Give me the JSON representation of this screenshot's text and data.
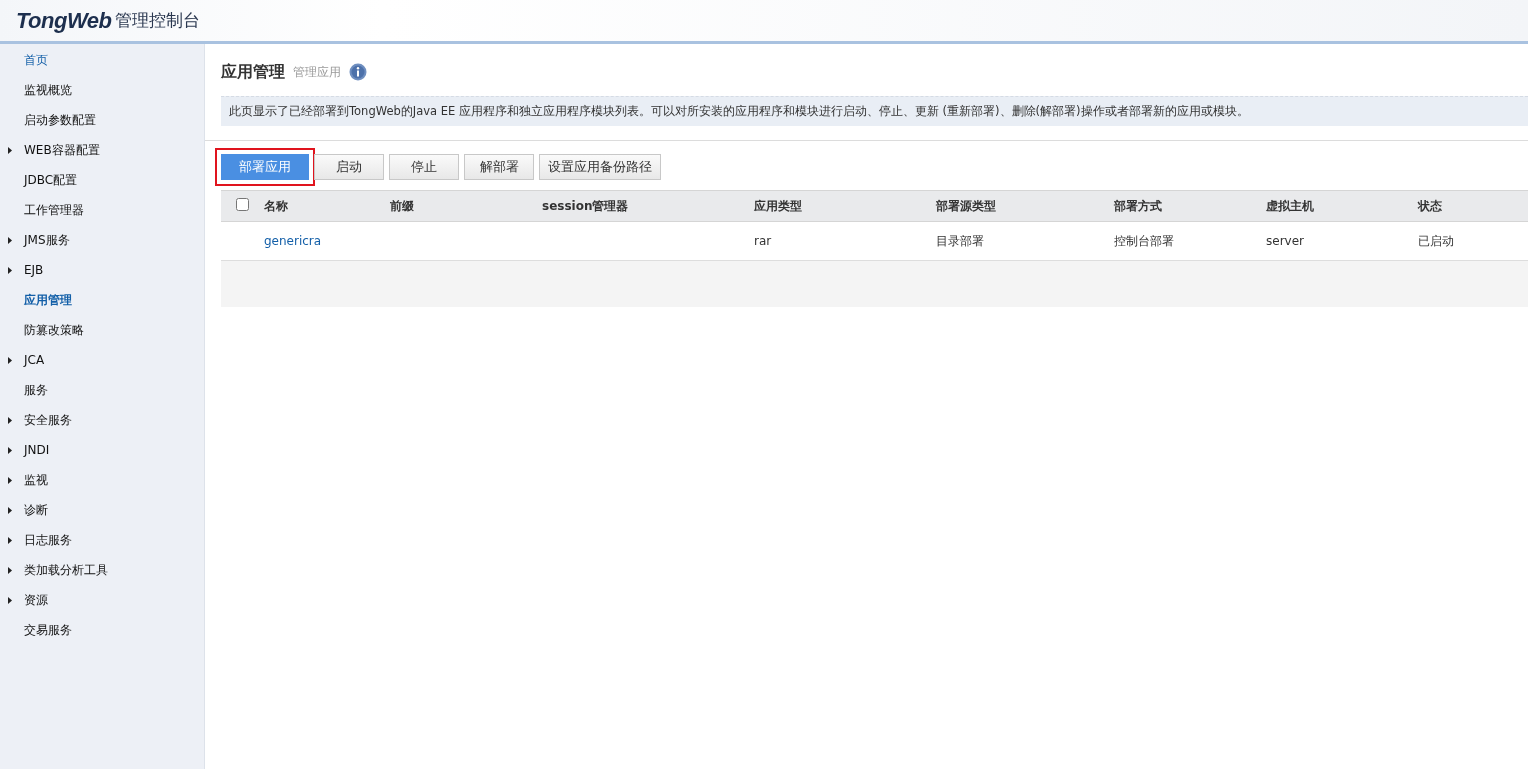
{
  "header": {
    "logo": "TongWeb",
    "title": "管理控制台"
  },
  "sidebar": {
    "items": [
      {
        "label": "首页",
        "kind": "link",
        "expandable": false,
        "selected": false
      },
      {
        "label": "监视概览",
        "kind": "item",
        "expandable": false,
        "selected": false
      },
      {
        "label": "启动参数配置",
        "kind": "item",
        "expandable": false,
        "selected": false
      },
      {
        "label": "WEB容器配置",
        "kind": "item",
        "expandable": true,
        "selected": false
      },
      {
        "label": "JDBC配置",
        "kind": "item",
        "expandable": false,
        "selected": false
      },
      {
        "label": "工作管理器",
        "kind": "item",
        "expandable": false,
        "selected": false
      },
      {
        "label": "JMS服务",
        "kind": "item",
        "expandable": true,
        "selected": false
      },
      {
        "label": "EJB",
        "kind": "item",
        "expandable": true,
        "selected": false
      },
      {
        "label": "应用管理",
        "kind": "item",
        "expandable": false,
        "selected": true
      },
      {
        "label": "防篡改策略",
        "kind": "item",
        "expandable": false,
        "selected": false
      },
      {
        "label": "JCA",
        "kind": "item",
        "expandable": true,
        "selected": false
      },
      {
        "label": "服务",
        "kind": "item",
        "expandable": false,
        "selected": false
      },
      {
        "label": "安全服务",
        "kind": "item",
        "expandable": true,
        "selected": false
      },
      {
        "label": "JNDI",
        "kind": "item",
        "expandable": true,
        "selected": false
      },
      {
        "label": "监视",
        "kind": "item",
        "expandable": true,
        "selected": false
      },
      {
        "label": "诊断",
        "kind": "item",
        "expandable": true,
        "selected": false
      },
      {
        "label": "日志服务",
        "kind": "item",
        "expandable": true,
        "selected": false
      },
      {
        "label": "类加载分析工具",
        "kind": "item",
        "expandable": true,
        "selected": false
      },
      {
        "label": "资源",
        "kind": "item",
        "expandable": true,
        "selected": false
      },
      {
        "label": "交易服务",
        "kind": "item",
        "expandable": false,
        "selected": false
      }
    ]
  },
  "page": {
    "title": "应用管理",
    "subtitle": "管理应用",
    "description": "此页显示了已经部署到TongWeb的Java EE 应用程序和独立应用程序模块列表。可以对所安装的应用程序和模块进行启动、停止、更新 (重新部署)、删除(解部署)操作或者部署新的应用或模块。"
  },
  "buttons": [
    {
      "label": "部署应用",
      "kind": "primary",
      "highlighted": true
    },
    {
      "label": "启动",
      "kind": "default",
      "highlighted": false
    },
    {
      "label": "停止",
      "kind": "default",
      "highlighted": false
    },
    {
      "label": "解部署",
      "kind": "default",
      "highlighted": false
    },
    {
      "label": "设置应用备份路径",
      "kind": "default",
      "highlighted": false
    }
  ],
  "table": {
    "select_all": {
      "checked": false
    },
    "columns": [
      "名称",
      "前缀",
      "session管理器",
      "应用类型",
      "部署源类型",
      "部署方式",
      "虚拟主机",
      "状态"
    ],
    "rows": [
      {
        "cells": [
          "genericra",
          "",
          "",
          "rar",
          "目录部署",
          "控制台部署",
          "server",
          "已启动"
        ]
      }
    ]
  }
}
